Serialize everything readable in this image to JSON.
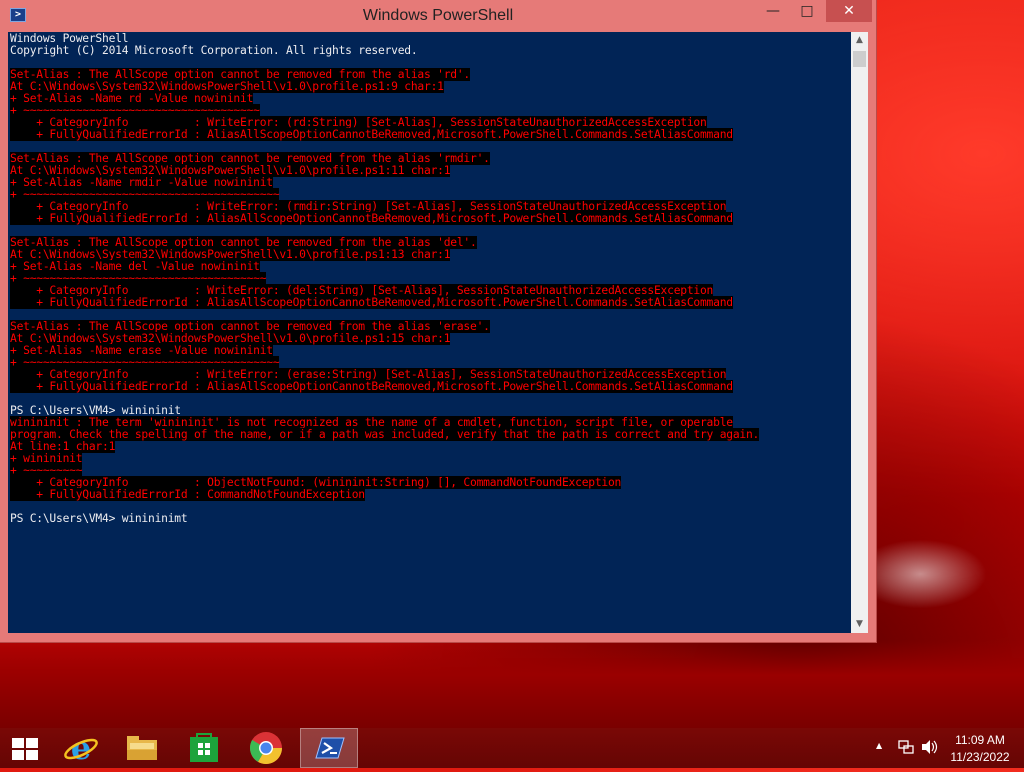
{
  "window": {
    "title": "Windows PowerShell",
    "controls": {
      "minimize": "—",
      "maximize": "□",
      "close": "✕"
    }
  },
  "console": {
    "lines": [
      {
        "style": "white",
        "text": "Windows PowerShell"
      },
      {
        "style": "white",
        "text": "Copyright (C) 2014 Microsoft Corporation. All rights reserved."
      },
      {
        "style": "blank",
        "text": ""
      },
      {
        "style": "err",
        "text": "Set-Alias : The AllScope option cannot be removed from the alias 'rd'."
      },
      {
        "style": "err",
        "text": "At C:\\Windows\\System32\\WindowsPowerShell\\v1.0\\profile.ps1:9 char:1"
      },
      {
        "style": "err",
        "text": "+ Set-Alias -Name rd -Value nowininit"
      },
      {
        "style": "err",
        "text": "+ ~~~~~~~~~~~~~~~~~~~~~~~~~~~~~~~~~~~~"
      },
      {
        "style": "err",
        "text": "    + CategoryInfo          : WriteError: (rd:String) [Set-Alias], SessionStateUnauthorizedAccessException"
      },
      {
        "style": "err",
        "text": "    + FullyQualifiedErrorId : AliasAllScopeOptionCannotBeRemoved,Microsoft.PowerShell.Commands.SetAliasCommand"
      },
      {
        "style": "blank",
        "text": ""
      },
      {
        "style": "err",
        "text": "Set-Alias : The AllScope option cannot be removed from the alias 'rmdir'."
      },
      {
        "style": "err",
        "text": "At C:\\Windows\\System32\\WindowsPowerShell\\v1.0\\profile.ps1:11 char:1"
      },
      {
        "style": "err",
        "text": "+ Set-Alias -Name rmdir -Value nowininit"
      },
      {
        "style": "err",
        "text": "+ ~~~~~~~~~~~~~~~~~~~~~~~~~~~~~~~~~~~~~~~"
      },
      {
        "style": "err",
        "text": "    + CategoryInfo          : WriteError: (rmdir:String) [Set-Alias], SessionStateUnauthorizedAccessException"
      },
      {
        "style": "err",
        "text": "    + FullyQualifiedErrorId : AliasAllScopeOptionCannotBeRemoved,Microsoft.PowerShell.Commands.SetAliasCommand"
      },
      {
        "style": "blank",
        "text": ""
      },
      {
        "style": "err",
        "text": "Set-Alias : The AllScope option cannot be removed from the alias 'del'."
      },
      {
        "style": "err",
        "text": "At C:\\Windows\\System32\\WindowsPowerShell\\v1.0\\profile.ps1:13 char:1"
      },
      {
        "style": "err",
        "text": "+ Set-Alias -Name del -Value nowininit"
      },
      {
        "style": "err",
        "text": "+ ~~~~~~~~~~~~~~~~~~~~~~~~~~~~~~~~~~~~~"
      },
      {
        "style": "err",
        "text": "    + CategoryInfo          : WriteError: (del:String) [Set-Alias], SessionStateUnauthorizedAccessException"
      },
      {
        "style": "err",
        "text": "    + FullyQualifiedErrorId : AliasAllScopeOptionCannotBeRemoved,Microsoft.PowerShell.Commands.SetAliasCommand"
      },
      {
        "style": "blank",
        "text": ""
      },
      {
        "style": "err",
        "text": "Set-Alias : The AllScope option cannot be removed from the alias 'erase'."
      },
      {
        "style": "err",
        "text": "At C:\\Windows\\System32\\WindowsPowerShell\\v1.0\\profile.ps1:15 char:1"
      },
      {
        "style": "err",
        "text": "+ Set-Alias -Name erase -Value nowininit"
      },
      {
        "style": "err",
        "text": "+ ~~~~~~~~~~~~~~~~~~~~~~~~~~~~~~~~~~~~~~~"
      },
      {
        "style": "err",
        "text": "    + CategoryInfo          : WriteError: (erase:String) [Set-Alias], SessionStateUnauthorizedAccessException"
      },
      {
        "style": "err",
        "text": "    + FullyQualifiedErrorId : AliasAllScopeOptionCannotBeRemoved,Microsoft.PowerShell.Commands.SetAliasCommand"
      },
      {
        "style": "blank",
        "text": ""
      },
      {
        "style": "white",
        "text": "PS C:\\Users\\VM4> winininit"
      },
      {
        "style": "err",
        "text": "winininit : The term 'winininit' is not recognized as the name of a cmdlet, function, script file, or operable"
      },
      {
        "style": "err",
        "text": "program. Check the spelling of the name, or if a path was included, verify that the path is correct and try again."
      },
      {
        "style": "err",
        "text": "At line:1 char:1"
      },
      {
        "style": "err",
        "text": "+ winininit"
      },
      {
        "style": "err",
        "text": "+ ~~~~~~~~~"
      },
      {
        "style": "err",
        "text": "    + CategoryInfo          : ObjectNotFound: (winininit:String) [], CommandNotFoundException"
      },
      {
        "style": "err",
        "text": "    + FullyQualifiedErrorId : CommandNotFoundException"
      },
      {
        "style": "blank",
        "text": ""
      },
      {
        "style": "white",
        "text": "PS C:\\Users\\VM4> winininimt"
      }
    ]
  },
  "scrollbar": {
    "up": "▲",
    "down": "▼"
  },
  "taskbar": {
    "pinned": [
      "start-button",
      "internet-explorer",
      "file-explorer",
      "store",
      "chrome",
      "powershell"
    ],
    "active_item": "powershell",
    "tray": {
      "time": "11:09 AM",
      "date": "11/23/2022",
      "show_hidden": "▲"
    }
  },
  "colors": {
    "console_bg": "#012456",
    "error_fg": "#ff0000",
    "error_bg": "#000000",
    "window_frame": "#e67a78",
    "close_button": "#c75050"
  }
}
